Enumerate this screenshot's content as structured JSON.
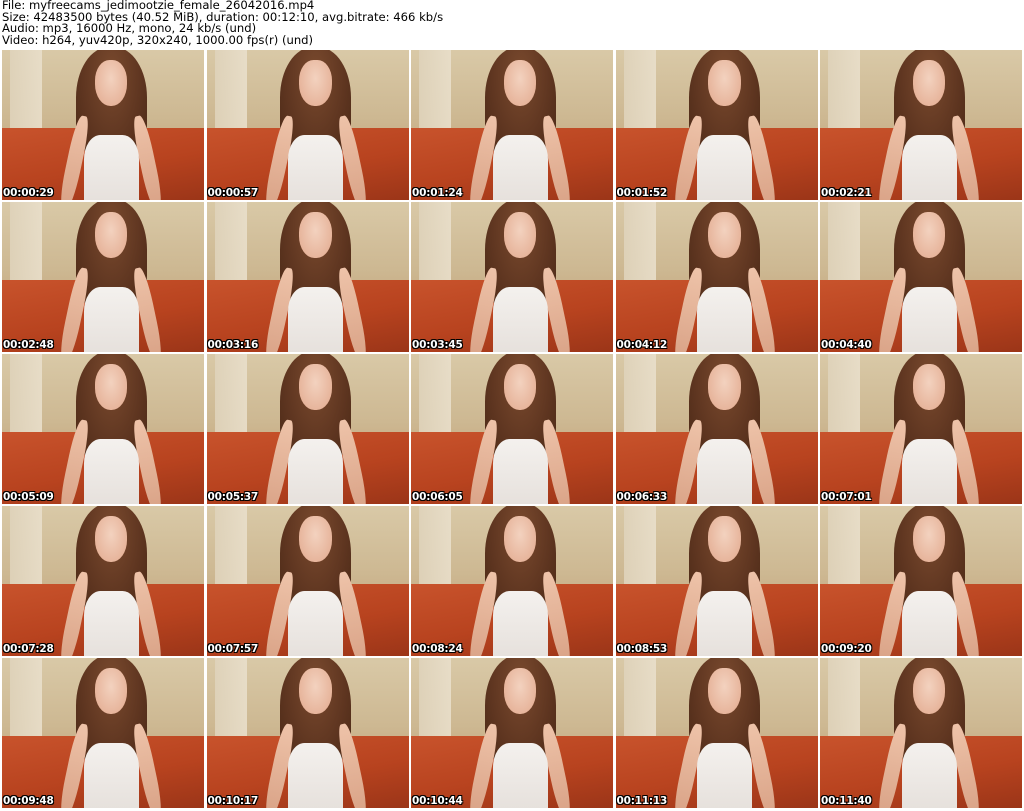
{
  "header": {
    "file_line": "File: myfreecams_jedimootzie_female_26042016.mp4",
    "size_line": "Size: 42483500 bytes (40.52 MiB), duration: 00:12:10, avg.bitrate: 466 kb/s",
    "audio_line": "Audio: mp3, 16000 Hz, mono, 24 kb/s (und)",
    "video_line": "Video: h264, yuv420p, 320x240, 1000.00 fps(r) (und)"
  },
  "thumbnails": [
    {
      "timestamp": "00:00:29"
    },
    {
      "timestamp": "00:00:57"
    },
    {
      "timestamp": "00:01:24"
    },
    {
      "timestamp": "00:01:52"
    },
    {
      "timestamp": "00:02:21"
    },
    {
      "timestamp": "00:02:48"
    },
    {
      "timestamp": "00:03:16"
    },
    {
      "timestamp": "00:03:45"
    },
    {
      "timestamp": "00:04:12"
    },
    {
      "timestamp": "00:04:40"
    },
    {
      "timestamp": "00:05:09"
    },
    {
      "timestamp": "00:05:37"
    },
    {
      "timestamp": "00:06:05"
    },
    {
      "timestamp": "00:06:33"
    },
    {
      "timestamp": "00:07:01"
    },
    {
      "timestamp": "00:07:28"
    },
    {
      "timestamp": "00:07:57"
    },
    {
      "timestamp": "00:08:24"
    },
    {
      "timestamp": "00:08:53"
    },
    {
      "timestamp": "00:09:20"
    },
    {
      "timestamp": "00:09:48"
    },
    {
      "timestamp": "00:10:17"
    },
    {
      "timestamp": "00:10:44"
    },
    {
      "timestamp": "00:11:13"
    },
    {
      "timestamp": "00:11:40"
    }
  ]
}
